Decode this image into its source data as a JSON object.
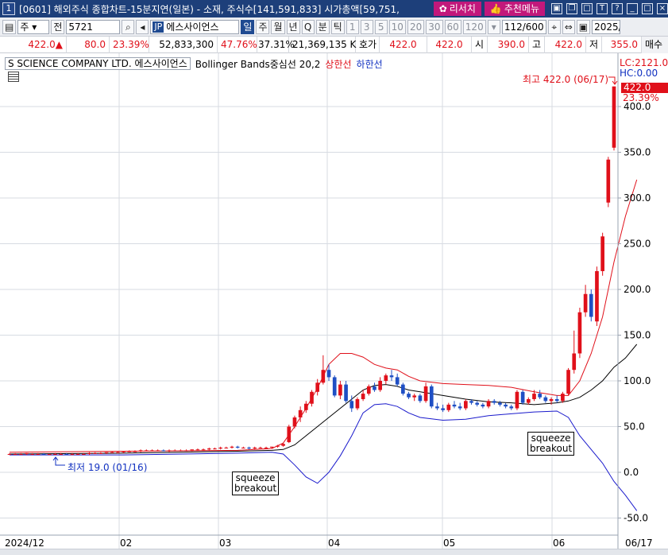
{
  "window": {
    "number": "1",
    "title": "[0601] 해외주식 종합차트-15분지연(일본) - 소재, 주식수[141,591,833] 시가총액[59,751,",
    "research_label": "리서치",
    "recommend_label": "추천메뉴",
    "icons": [
      "tile-icon",
      "restore-icon",
      "maximize-icon",
      "font-icon",
      "help-icon",
      "minimize-icon",
      "max-icon",
      "close-icon"
    ]
  },
  "toolbar": {
    "market_select": "주",
    "prev_btn": "전",
    "code": "5721",
    "country": "JP",
    "name": "에스사이언스",
    "periods": [
      {
        "label": "일",
        "selected": true
      },
      {
        "label": "주",
        "selected": false
      },
      {
        "label": "월",
        "selected": false
      },
      {
        "label": "년",
        "selected": false
      },
      {
        "label": "Q",
        "selected": false
      },
      {
        "label": "분",
        "selected": false
      },
      {
        "label": "틱",
        "selected": false
      }
    ],
    "intervals": [
      "1",
      "3",
      "5",
      "10",
      "20",
      "30",
      "60",
      "120"
    ],
    "count": "112/600",
    "date": "2025/"
  },
  "quote": {
    "price": "422.0▲",
    "change": "80.0",
    "change_pct": "23.39%",
    "volume": "52,833,300",
    "vol_ratio": "47.76%",
    "turnover_pct": "37.31%",
    "amount": "21,369,135 K",
    "ask_label": "호가",
    "ask1": "422.0",
    "ask2": "422.0",
    "open_label": "시",
    "open": "390.0",
    "high_label": "고",
    "high": "422.0",
    "low_label": "저",
    "low": "355.0",
    "buy_label": "매수"
  },
  "legend": {
    "company": "S SCIENCE COMPANY LTD.  에스사이언스",
    "indicator": "Bollinger Bands중심선 20,2",
    "upper": "상한선",
    "lower": "하한선"
  },
  "right_axis": {
    "lc": "LC:2121.05",
    "hc": "HC:0.00",
    "last_price": "422.0",
    "last_pct": "23.39%",
    "ticks": [
      "400.0",
      "350.0",
      "300.0",
      "250.0",
      "200.0",
      "150.0",
      "100.0",
      "50.0",
      "0.0",
      "-50.0"
    ]
  },
  "annotations": {
    "high": "최고 422.0 (06/17)",
    "low": "최저 19.0 (01/16)",
    "squeeze1_line1": "squeeze",
    "squeeze1_line2": "breakout",
    "squeeze2_line1": "squeeze",
    "squeeze2_line2": "breakout"
  },
  "x_axis": [
    "2024/12",
    "02",
    "03",
    "04",
    "05",
    "06",
    "06/17"
  ],
  "colors": {
    "up": "#e0101a",
    "down": "#1f4fc4",
    "upper_band": "#e0101a",
    "lower_band": "#1a1acc",
    "mid_band": "#000000"
  },
  "chart_data": {
    "type": "candlestick",
    "title": "",
    "ylim": [
      -50,
      430
    ],
    "x_range": [
      "2024/12",
      "06/17"
    ],
    "candles": [
      {
        "o": 20,
        "h": 21,
        "l": 19,
        "c": 20
      },
      {
        "o": 20,
        "h": 21,
        "l": 19,
        "c": 20
      },
      {
        "o": 20,
        "h": 21,
        "l": 19,
        "c": 20
      },
      {
        "o": 20,
        "h": 21,
        "l": 19,
        "c": 21
      },
      {
        "o": 20,
        "h": 21,
        "l": 19,
        "c": 20
      },
      {
        "o": 20,
        "h": 21,
        "l": 19,
        "c": 20
      },
      {
        "o": 20,
        "h": 21,
        "l": 19,
        "c": 19
      },
      {
        "o": 19,
        "h": 20,
        "l": 19,
        "c": 20
      },
      {
        "o": 20,
        "h": 21,
        "l": 19,
        "c": 20
      },
      {
        "o": 20,
        "h": 21,
        "l": 19,
        "c": 20
      },
      {
        "o": 20,
        "h": 21,
        "l": 19,
        "c": 19
      },
      {
        "o": 19,
        "h": 21,
        "l": 19,
        "c": 20
      },
      {
        "o": 20,
        "h": 21,
        "l": 19,
        "c": 20
      },
      {
        "o": 20,
        "h": 21,
        "l": 19,
        "c": 20
      },
      {
        "o": 20,
        "h": 22,
        "l": 19,
        "c": 21
      },
      {
        "o": 21,
        "h": 22,
        "l": 20,
        "c": 21
      },
      {
        "o": 21,
        "h": 22,
        "l": 20,
        "c": 21
      },
      {
        "o": 21,
        "h": 22,
        "l": 20,
        "c": 22
      },
      {
        "o": 22,
        "h": 23,
        "l": 21,
        "c": 22
      },
      {
        "o": 22,
        "h": 23,
        "l": 21,
        "c": 22
      },
      {
        "o": 22,
        "h": 23,
        "l": 21,
        "c": 23
      },
      {
        "o": 23,
        "h": 24,
        "l": 22,
        "c": 23
      },
      {
        "o": 23,
        "h": 24,
        "l": 22,
        "c": 23
      },
      {
        "o": 23,
        "h": 25,
        "l": 22,
        "c": 24
      },
      {
        "o": 24,
        "h": 25,
        "l": 23,
        "c": 24
      },
      {
        "o": 24,
        "h": 25,
        "l": 23,
        "c": 24
      },
      {
        "o": 24,
        "h": 25,
        "l": 23,
        "c": 24
      },
      {
        "o": 24,
        "h": 25,
        "l": 23,
        "c": 23
      },
      {
        "o": 23,
        "h": 25,
        "l": 22,
        "c": 24
      },
      {
        "o": 24,
        "h": 25,
        "l": 23,
        "c": 24
      },
      {
        "o": 24,
        "h": 25,
        "l": 23,
        "c": 24
      },
      {
        "o": 24,
        "h": 25,
        "l": 23,
        "c": 24
      },
      {
        "o": 24,
        "h": 25,
        "l": 23,
        "c": 25
      },
      {
        "o": 25,
        "h": 26,
        "l": 24,
        "c": 25
      },
      {
        "o": 25,
        "h": 26,
        "l": 24,
        "c": 25
      },
      {
        "o": 25,
        "h": 27,
        "l": 24,
        "c": 26
      },
      {
        "o": 26,
        "h": 27,
        "l": 25,
        "c": 26
      },
      {
        "o": 26,
        "h": 28,
        "l": 25,
        "c": 27
      },
      {
        "o": 27,
        "h": 28,
        "l": 26,
        "c": 27
      },
      {
        "o": 27,
        "h": 29,
        "l": 26,
        "c": 28
      },
      {
        "o": 28,
        "h": 29,
        "l": 26,
        "c": 27
      },
      {
        "o": 27,
        "h": 28,
        "l": 26,
        "c": 27
      },
      {
        "o": 27,
        "h": 28,
        "l": 25,
        "c": 26
      },
      {
        "o": 26,
        "h": 28,
        "l": 25,
        "c": 27
      },
      {
        "o": 27,
        "h": 28,
        "l": 26,
        "c": 27
      },
      {
        "o": 27,
        "h": 28,
        "l": 26,
        "c": 27
      },
      {
        "o": 27,
        "h": 28,
        "l": 26,
        "c": 28
      },
      {
        "o": 28,
        "h": 30,
        "l": 27,
        "c": 29
      },
      {
        "o": 29,
        "h": 32,
        "l": 28,
        "c": 31
      },
      {
        "o": 33,
        "h": 52,
        "l": 32,
        "c": 50
      },
      {
        "o": 50,
        "h": 62,
        "l": 48,
        "c": 60
      },
      {
        "o": 60,
        "h": 72,
        "l": 55,
        "c": 68
      },
      {
        "o": 68,
        "h": 78,
        "l": 65,
        "c": 75
      },
      {
        "o": 75,
        "h": 90,
        "l": 72,
        "c": 88
      },
      {
        "o": 88,
        "h": 102,
        "l": 84,
        "c": 98
      },
      {
        "o": 98,
        "h": 128,
        "l": 96,
        "c": 112
      },
      {
        "o": 112,
        "h": 118,
        "l": 100,
        "c": 104
      },
      {
        "o": 104,
        "h": 106,
        "l": 82,
        "c": 84
      },
      {
        "o": 84,
        "h": 100,
        "l": 80,
        "c": 96
      },
      {
        "o": 96,
        "h": 100,
        "l": 76,
        "c": 78
      },
      {
        "o": 78,
        "h": 84,
        "l": 66,
        "c": 70
      },
      {
        "o": 70,
        "h": 82,
        "l": 68,
        "c": 80
      },
      {
        "o": 80,
        "h": 90,
        "l": 78,
        "c": 86
      },
      {
        "o": 86,
        "h": 96,
        "l": 84,
        "c": 94
      },
      {
        "o": 94,
        "h": 98,
        "l": 88,
        "c": 90
      },
      {
        "o": 90,
        "h": 104,
        "l": 88,
        "c": 100
      },
      {
        "o": 100,
        "h": 108,
        "l": 96,
        "c": 106
      },
      {
        "o": 106,
        "h": 112,
        "l": 100,
        "c": 104
      },
      {
        "o": 104,
        "h": 108,
        "l": 94,
        "c": 96
      },
      {
        "o": 96,
        "h": 98,
        "l": 84,
        "c": 86
      },
      {
        "o": 86,
        "h": 88,
        "l": 80,
        "c": 82
      },
      {
        "o": 82,
        "h": 86,
        "l": 78,
        "c": 84
      },
      {
        "o": 84,
        "h": 86,
        "l": 76,
        "c": 78
      },
      {
        "o": 78,
        "h": 98,
        "l": 76,
        "c": 94
      },
      {
        "o": 94,
        "h": 96,
        "l": 70,
        "c": 72
      },
      {
        "o": 72,
        "h": 76,
        "l": 68,
        "c": 70
      },
      {
        "o": 70,
        "h": 74,
        "l": 66,
        "c": 68
      },
      {
        "o": 68,
        "h": 76,
        "l": 66,
        "c": 74
      },
      {
        "o": 74,
        "h": 78,
        "l": 70,
        "c": 72
      },
      {
        "o": 72,
        "h": 76,
        "l": 68,
        "c": 70
      },
      {
        "o": 70,
        "h": 80,
        "l": 68,
        "c": 78
      },
      {
        "o": 78,
        "h": 80,
        "l": 74,
        "c": 76
      },
      {
        "o": 76,
        "h": 78,
        "l": 72,
        "c": 74
      },
      {
        "o": 74,
        "h": 76,
        "l": 70,
        "c": 72
      },
      {
        "o": 72,
        "h": 80,
        "l": 70,
        "c": 78
      },
      {
        "o": 78,
        "h": 80,
        "l": 74,
        "c": 76
      },
      {
        "o": 76,
        "h": 78,
        "l": 72,
        "c": 74
      },
      {
        "o": 74,
        "h": 76,
        "l": 70,
        "c": 72
      },
      {
        "o": 72,
        "h": 74,
        "l": 68,
        "c": 70
      },
      {
        "o": 70,
        "h": 90,
        "l": 68,
        "c": 88
      },
      {
        "o": 88,
        "h": 90,
        "l": 74,
        "c": 76
      },
      {
        "o": 76,
        "h": 82,
        "l": 74,
        "c": 80
      },
      {
        "o": 80,
        "h": 90,
        "l": 78,
        "c": 86
      },
      {
        "o": 86,
        "h": 90,
        "l": 80,
        "c": 82
      },
      {
        "o": 82,
        "h": 84,
        "l": 76,
        "c": 78
      },
      {
        "o": 78,
        "h": 82,
        "l": 74,
        "c": 80
      },
      {
        "o": 80,
        "h": 84,
        "l": 76,
        "c": 78
      },
      {
        "o": 78,
        "h": 88,
        "l": 76,
        "c": 86
      },
      {
        "o": 86,
        "h": 114,
        "l": 84,
        "c": 112
      },
      {
        "o": 112,
        "h": 155,
        "l": 108,
        "c": 130
      },
      {
        "o": 130,
        "h": 180,
        "l": 125,
        "c": 175
      },
      {
        "o": 175,
        "h": 205,
        "l": 170,
        "c": 195
      },
      {
        "o": 195,
        "h": 200,
        "l": 165,
        "c": 170
      },
      {
        "o": 165,
        "h": 225,
        "l": 160,
        "c": 220
      },
      {
        "o": 220,
        "h": 262,
        "l": 215,
        "c": 258
      },
      {
        "o": 295,
        "h": 345,
        "l": 290,
        "c": 342
      },
      {
        "o": 355,
        "h": 422,
        "l": 352,
        "c": 422
      }
    ],
    "upper_band": [
      [
        0,
        22
      ],
      [
        20,
        23
      ],
      [
        40,
        24
      ],
      [
        46,
        26
      ],
      [
        48,
        32
      ],
      [
        50,
        50
      ],
      [
        52,
        70
      ],
      [
        54,
        92
      ],
      [
        56,
        118
      ],
      [
        58,
        130
      ],
      [
        60,
        130
      ],
      [
        62,
        126
      ],
      [
        64,
        118
      ],
      [
        66,
        114
      ],
      [
        68,
        112
      ],
      [
        70,
        105
      ],
      [
        72,
        100
      ],
      [
        76,
        97
      ],
      [
        80,
        96
      ],
      [
        84,
        95
      ],
      [
        88,
        93
      ],
      [
        92,
        88
      ],
      [
        96,
        84
      ],
      [
        98,
        84
      ],
      [
        100,
        100
      ],
      [
        102,
        130
      ],
      [
        104,
        170
      ],
      [
        106,
        230
      ],
      [
        108,
        280
      ],
      [
        110,
        320
      ]
    ],
    "mid_band": [
      [
        0,
        20
      ],
      [
        20,
        21
      ],
      [
        40,
        23
      ],
      [
        46,
        24
      ],
      [
        48,
        25
      ],
      [
        50,
        30
      ],
      [
        52,
        40
      ],
      [
        54,
        50
      ],
      [
        56,
        60
      ],
      [
        58,
        70
      ],
      [
        60,
        80
      ],
      [
        62,
        90
      ],
      [
        64,
        95
      ],
      [
        66,
        96
      ],
      [
        68,
        94
      ],
      [
        70,
        90
      ],
      [
        72,
        88
      ],
      [
        76,
        84
      ],
      [
        80,
        80
      ],
      [
        84,
        77
      ],
      [
        88,
        76
      ],
      [
        92,
        74
      ],
      [
        96,
        76
      ],
      [
        98,
        78
      ],
      [
        100,
        82
      ],
      [
        102,
        90
      ],
      [
        104,
        100
      ],
      [
        106,
        115
      ],
      [
        108,
        125
      ],
      [
        110,
        140
      ]
    ],
    "lower_band": [
      [
        0,
        19
      ],
      [
        20,
        19
      ],
      [
        40,
        21
      ],
      [
        46,
        22
      ],
      [
        48,
        20
      ],
      [
        50,
        8
      ],
      [
        52,
        -5
      ],
      [
        54,
        -12
      ],
      [
        56,
        0
      ],
      [
        58,
        18
      ],
      [
        60,
        40
      ],
      [
        62,
        65
      ],
      [
        64,
        74
      ],
      [
        66,
        75
      ],
      [
        68,
        72
      ],
      [
        70,
        65
      ],
      [
        72,
        60
      ],
      [
        76,
        57
      ],
      [
        80,
        58
      ],
      [
        84,
        62
      ],
      [
        88,
        64
      ],
      [
        92,
        66
      ],
      [
        96,
        67
      ],
      [
        98,
        60
      ],
      [
        100,
        40
      ],
      [
        102,
        25
      ],
      [
        104,
        10
      ],
      [
        106,
        -10
      ],
      [
        108,
        -25
      ],
      [
        110,
        -42
      ]
    ]
  }
}
